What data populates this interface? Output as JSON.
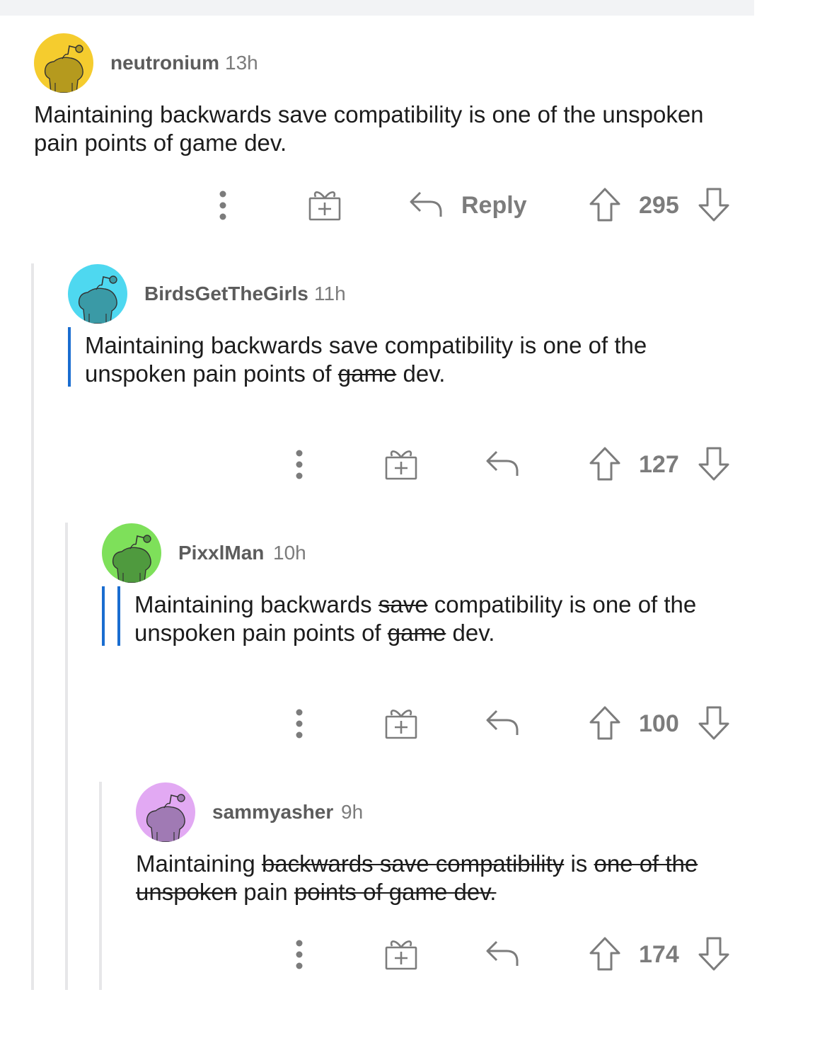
{
  "comments": [
    {
      "author": "neutronium",
      "time": "13h",
      "avatar_color": "#f5cc2e",
      "avatar_figure_color": "#b59a1e",
      "body": [
        {
          "t": "Maintaining backwards save compatibility is one of the unspoken pain points of game dev.",
          "s": false
        }
      ],
      "reply_label": "Reply",
      "votes": "295"
    },
    {
      "author": "BirdsGetTheGirls",
      "time": "11h",
      "avatar_color": "#4ed8f0",
      "avatar_figure_color": "#3a9aa6",
      "body": [
        {
          "t": "Maintaining backwards save compatibility is one of the unspoken pain points of ",
          "s": false
        },
        {
          "t": "game",
          "s": true
        },
        {
          "t": " dev.",
          "s": false
        }
      ],
      "votes": "127"
    },
    {
      "author": "PixxlMan",
      "time": "10h",
      "avatar_color": "#7ee05a",
      "avatar_figure_color": "#4f9a3e",
      "body": [
        {
          "t": "Maintaining backwards ",
          "s": false
        },
        {
          "t": "save",
          "s": true
        },
        {
          "t": " compatibility is one of the unspoken pain points of ",
          "s": false
        },
        {
          "t": "game",
          "s": true
        },
        {
          "t": " dev.",
          "s": false
        }
      ],
      "votes": "100"
    },
    {
      "author": "sammyasher",
      "time": "9h",
      "avatar_color": "#e2a9f3",
      "avatar_figure_color": "#a07ab4",
      "body": [
        {
          "t": "Maintaining ",
          "s": false
        },
        {
          "t": "backwards save compatibility",
          "s": true
        },
        {
          "t": " is ",
          "s": false
        },
        {
          "t": "one of the unspoken",
          "s": true
        },
        {
          "t": " pain ",
          "s": false
        },
        {
          "t": "points of game dev.",
          "s": true
        }
      ],
      "votes": "174"
    }
  ],
  "icons": {
    "more": "more-options-icon",
    "award": "gift-award-icon",
    "reply": "reply-arrow-icon",
    "upvote": "upvote-arrow-icon",
    "downvote": "downvote-arrow-icon"
  },
  "colors": {
    "quote_bar": "#1a6dd0",
    "thread_line": "#e7e7e9",
    "meta_text": "#7c7c7c"
  }
}
